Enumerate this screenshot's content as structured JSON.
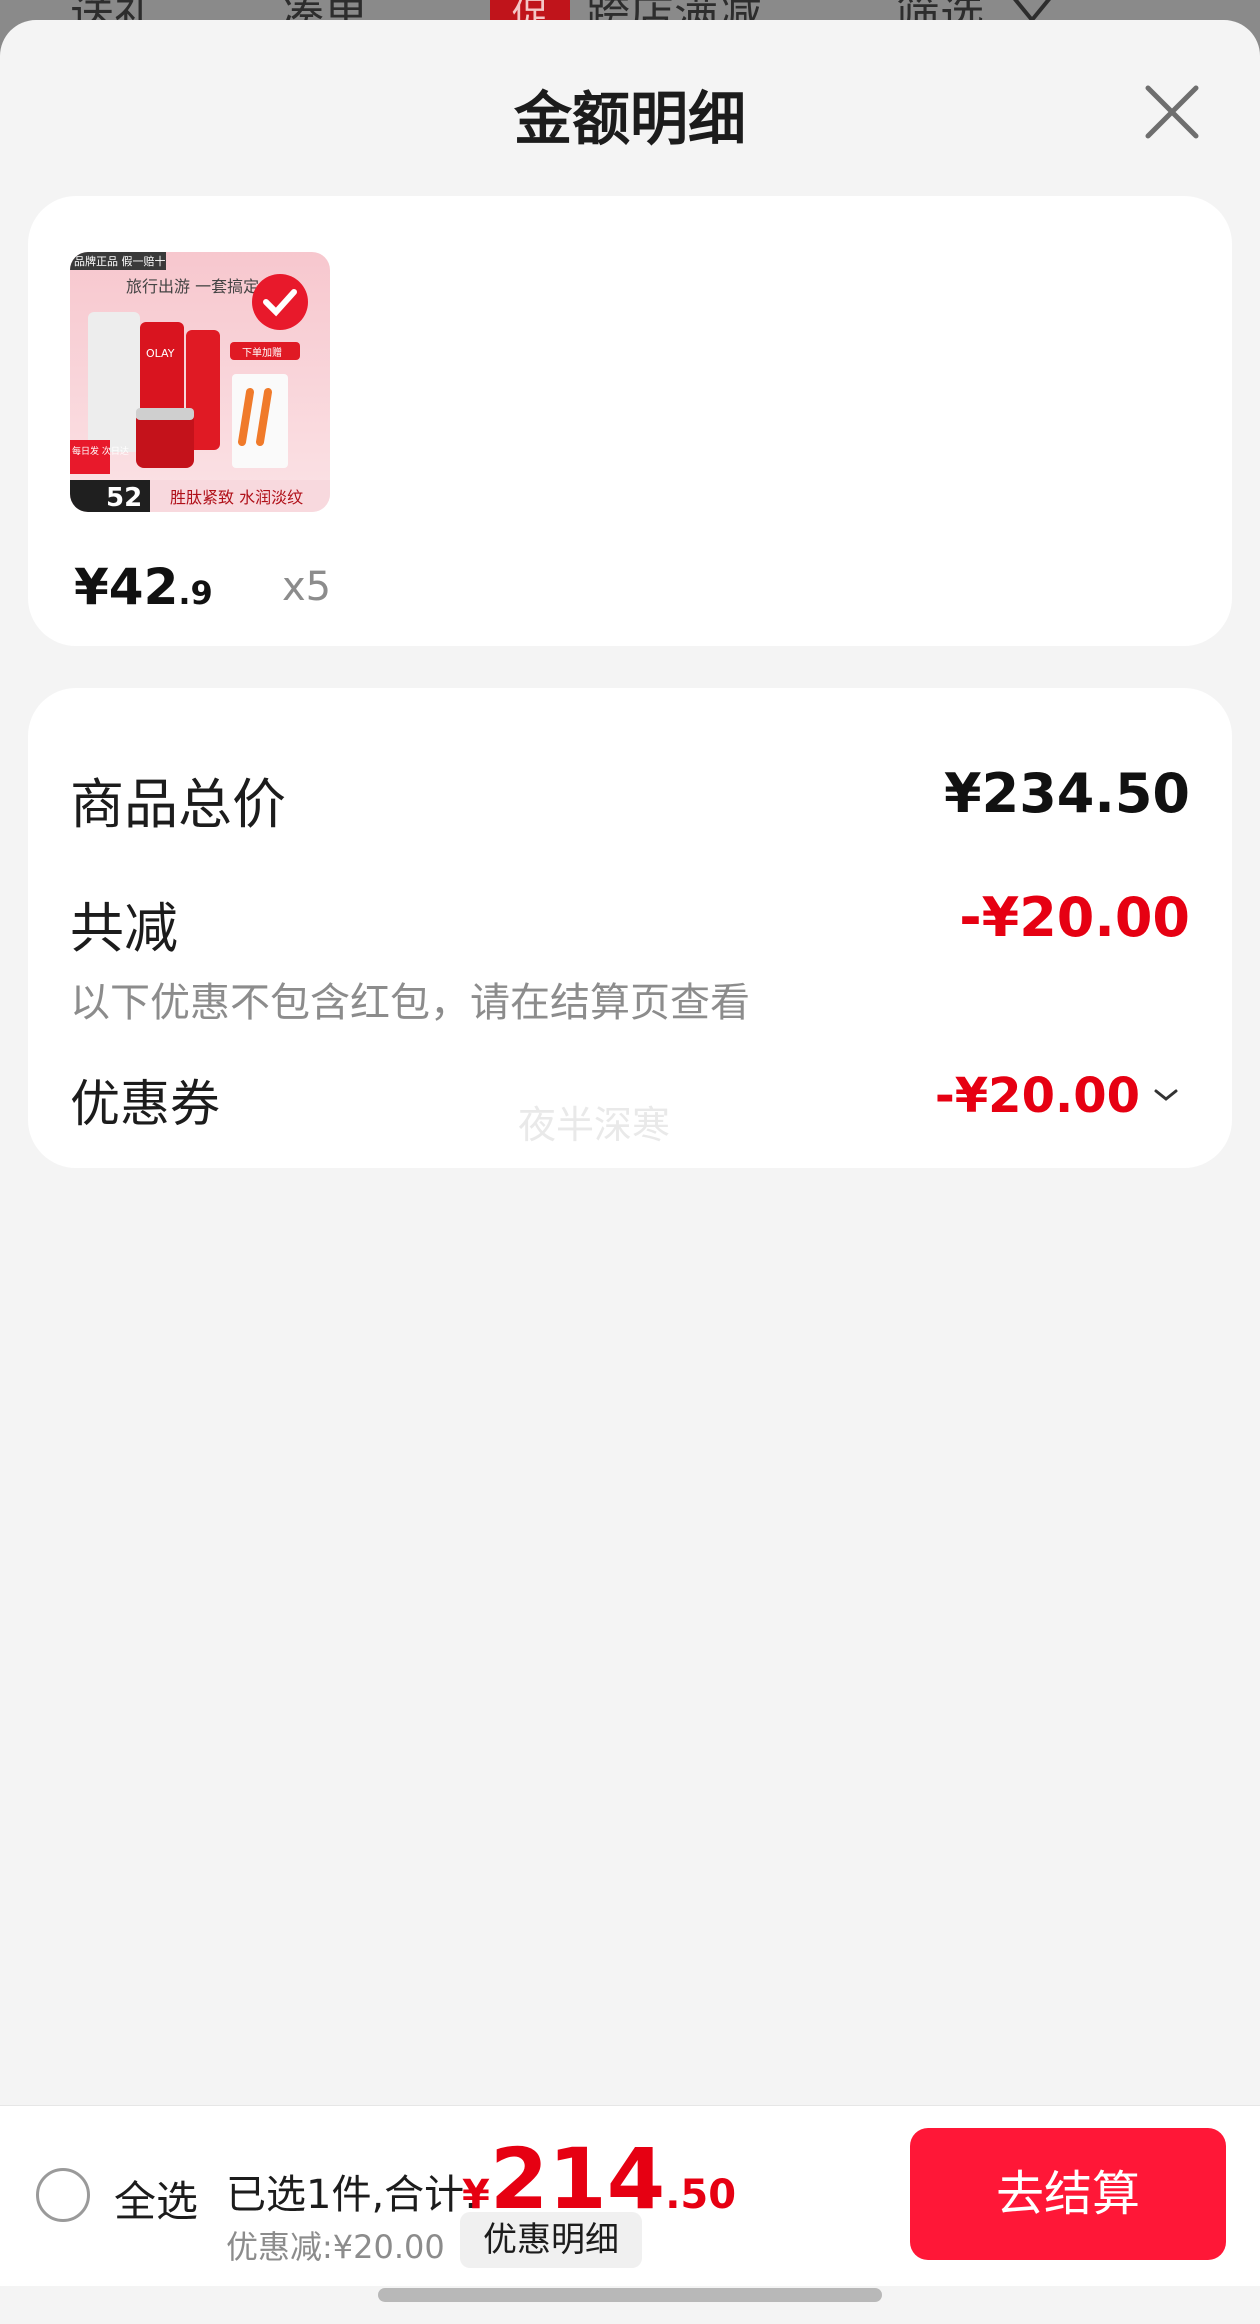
{
  "topbar": {
    "items": [
      "送礼",
      "凑单",
      "跨店满减",
      "筛选"
    ],
    "promo_badge": "促"
  },
  "sheet": {
    "title": "金额明细"
  },
  "product": {
    "image_texts": {
      "brand_tag": "品牌正品 假一赔十",
      "headline": "旅行出游 一套搞定",
      "order_tag": "下单加赠",
      "day_tag": "每日发 次日达",
      "badge_num": "52",
      "features": "胜肽紧致 水润淡纹",
      "logo": "OLAY"
    },
    "price_int": "¥42",
    "price_dec": ".9",
    "quantity": "x5"
  },
  "summary": {
    "total_label": "商品总价",
    "total_value": "¥234.50",
    "discount_label": "共减",
    "discount_value": "-¥20.00",
    "discount_note": "以下优惠不包含红包，请在结算页查看",
    "coupon_label": "优惠券",
    "coupon_value": "-¥20.00",
    "watermark": "夜半深寒"
  },
  "bottom_bar": {
    "select_all": "全选",
    "selected_text": "已选1件,合计:",
    "total_symbol": "¥",
    "total_int": "214",
    "total_dec": ".50",
    "saved_text": "优惠减:¥20.00",
    "detail_button": "优惠明细",
    "checkout_button": "去结算"
  },
  "colors": {
    "accent_red": "#e60012",
    "checkout_bg": "#ff1737",
    "sheet_bg": "#f4f4f4"
  }
}
